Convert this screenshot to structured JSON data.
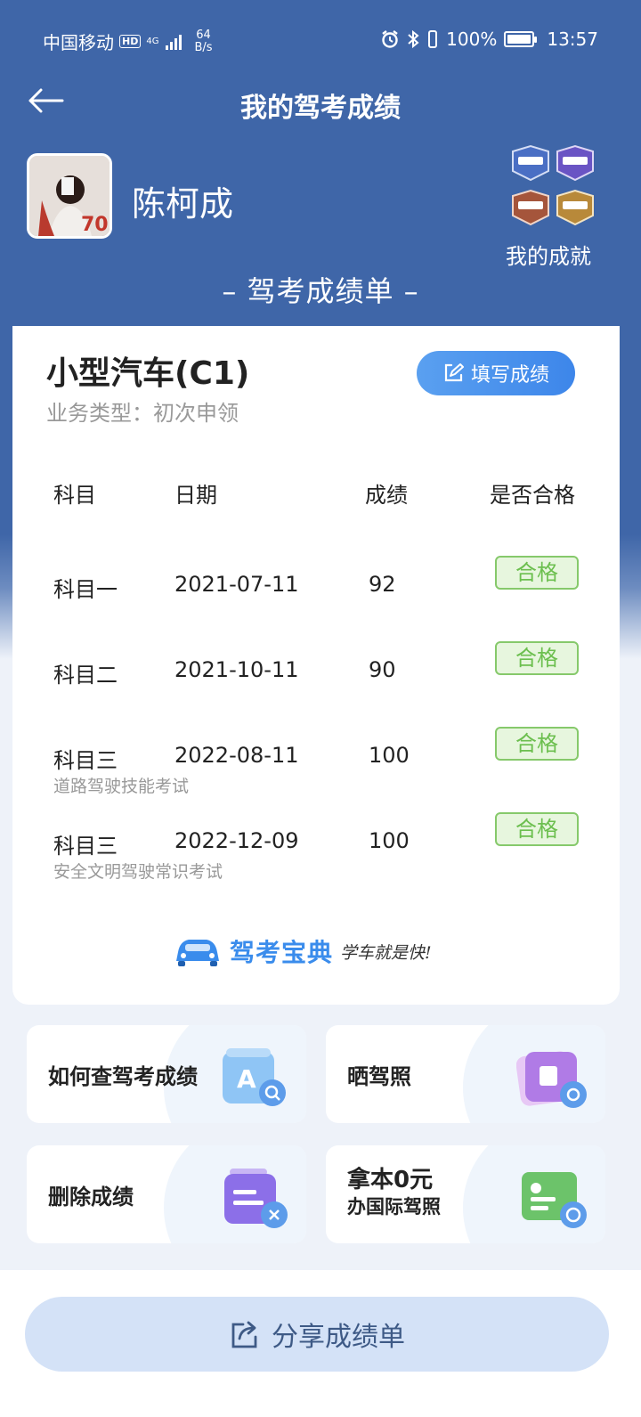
{
  "status_bar": {
    "carrier": "中国移动",
    "hd": "HD",
    "net": "4G",
    "speed_value": "64",
    "speed_unit": "B/s",
    "battery": "100%",
    "time": "13:57"
  },
  "nav": {
    "title": "我的驾考成绩"
  },
  "user": {
    "name": "陈柯成",
    "achievements_label": "我的成就"
  },
  "sheet": {
    "title": "– 驾考成绩单 –"
  },
  "license": {
    "type": "小型汽车(C1)",
    "business": "业务类型：初次申领",
    "fill_button": "填写成绩"
  },
  "table": {
    "headers": [
      "科目",
      "日期",
      "成绩",
      "是否合格"
    ],
    "rows": [
      {
        "subject": "科目一",
        "date": "2021-07-11",
        "score": "92",
        "status": "合格",
        "note": ""
      },
      {
        "subject": "科目二",
        "date": "2021-10-11",
        "score": "90",
        "status": "合格",
        "note": ""
      },
      {
        "subject": "科目三",
        "date": "2022-08-11",
        "score": "100",
        "status": "合格",
        "note": "道路驾驶技能考试"
      },
      {
        "subject": "科目三",
        "date": "2022-12-09",
        "score": "100",
        "status": "合格",
        "note": "安全文明驾驶常识考试"
      }
    ]
  },
  "brand": {
    "name": "驾考宝典",
    "slogan": "学车就是快!"
  },
  "tiles": [
    {
      "label": "如何查驾考成绩",
      "icon": "search-doc-icon"
    },
    {
      "label": "晒驾照",
      "icon": "photo-camera-icon"
    },
    {
      "label": "删除成绩",
      "icon": "delete-card-icon"
    },
    {
      "label_line1": "拿本0元",
      "label_line2": "办国际驾照",
      "icon": "intl-license-icon"
    }
  ],
  "share": {
    "label": "分享成绩单"
  },
  "colors": {
    "header_bg": "#3f66a8",
    "accent": "#3d86ea",
    "pass_green": "#6cbf4f"
  }
}
